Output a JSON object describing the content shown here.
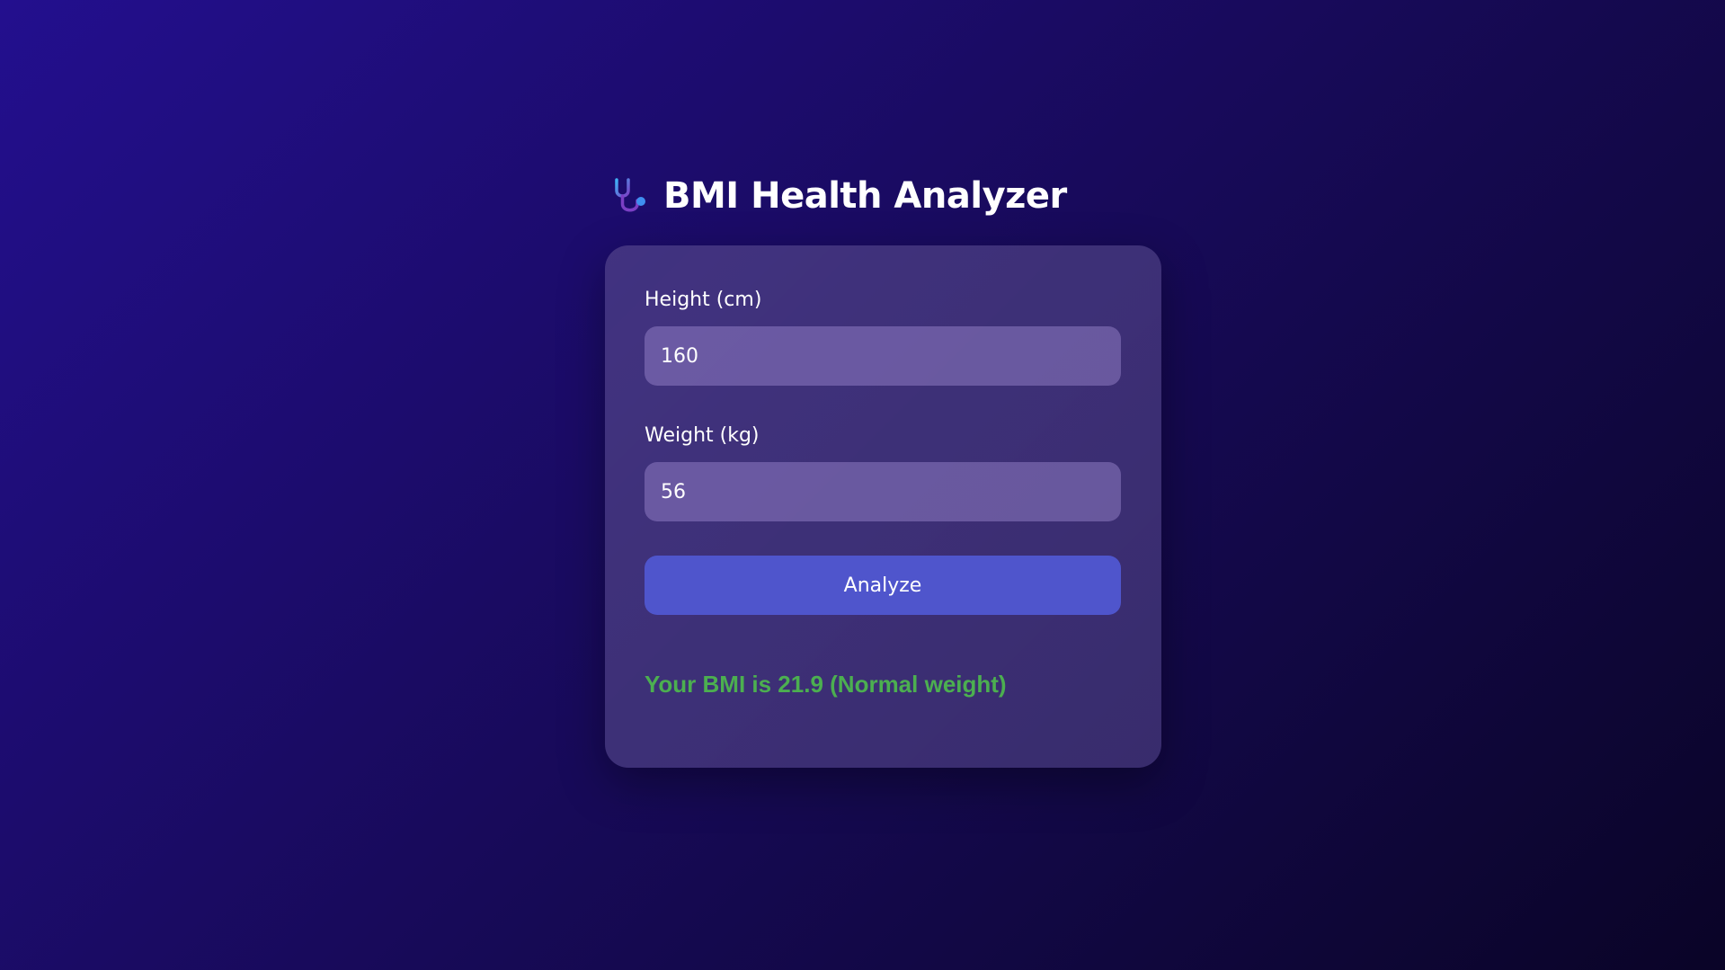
{
  "header": {
    "icon": "stethoscope-icon",
    "title": "BMI Health Analyzer"
  },
  "form": {
    "height_label": "Height (cm)",
    "height_value": "160",
    "weight_label": "Weight (kg)",
    "weight_value": "56",
    "analyze_label": "Analyze"
  },
  "result": {
    "text": "Your BMI is 21.9 (Normal weight)",
    "color": "#4caf50"
  },
  "colors": {
    "background_top": "#230f8e",
    "background_bottom": "#0a0427",
    "button": "#4f55cc"
  }
}
